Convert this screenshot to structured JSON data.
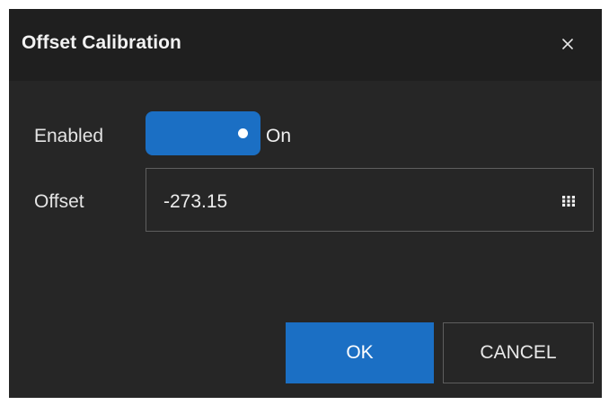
{
  "dialog": {
    "title": "Offset Calibration",
    "close_icon": "close-icon",
    "background": "#262626",
    "titlebar_background": "#1f1f1f"
  },
  "form": {
    "enabled_label": "Enabled",
    "enabled_state_text": "On",
    "enabled_value": true,
    "offset_label": "Offset",
    "offset_value": "-273.15",
    "keypad_icon": "keypad-icon"
  },
  "buttons": {
    "ok_label": "OK",
    "cancel_label": "CANCEL"
  },
  "colors": {
    "accent": "#1b6fc4",
    "border": "#5e5e5e",
    "text": "#e8e8e8"
  }
}
